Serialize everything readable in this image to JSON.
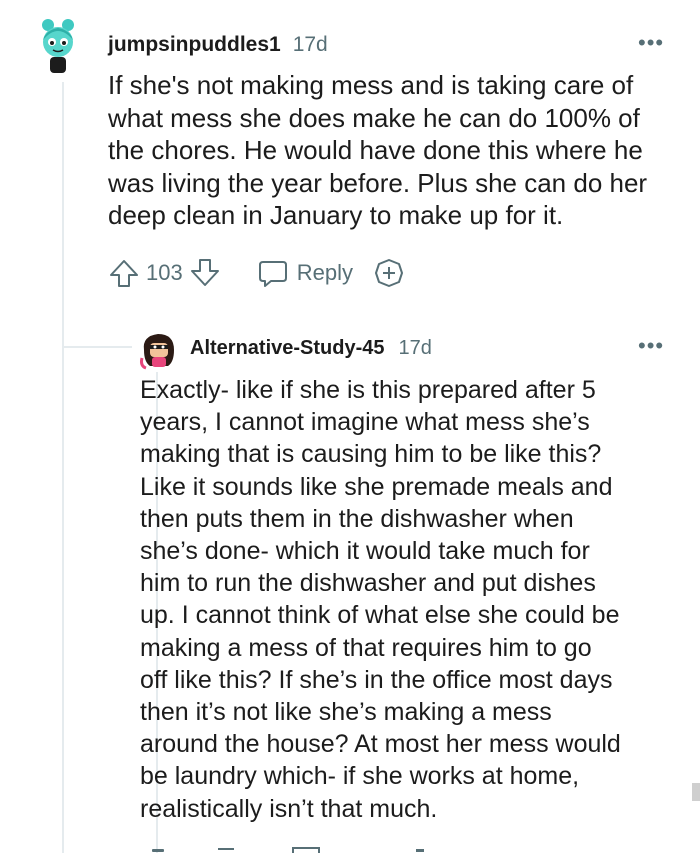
{
  "comment1": {
    "username": "jumpsinpuddles1",
    "age": "17d",
    "more_label": "•••",
    "lines": [
      "If she's not making mess and is taking care of",
      "what mess she does make he can do 100% of",
      "the chores. He would have done this where he",
      "was living the year before. Plus she can do her",
      "deep clean in January to make up for it."
    ],
    "score": "103",
    "reply_label": "Reply"
  },
  "comment2": {
    "username": "Alternative-Study-45",
    "age": "17d",
    "more_label": "•••",
    "lines": [
      "Exactly- like if she is this prepared after 5",
      "years, I cannot imagine what mess she’s",
      "making that is causing him to be like this?",
      "Like it sounds like she premade meals and",
      "then puts them in the dishwasher when",
      "she’s done- which it would take much for",
      "him to run the dishwasher and put dishes",
      "up. I cannot think of what else she could be",
      "making a mess of that requires him to go",
      "off like this? If she’s in the office most days",
      "then it’s not like she’s making a mess",
      "around the house? At most her mess would",
      "be laundry which- if she works at home,",
      "realistically isn’t that much."
    ]
  }
}
